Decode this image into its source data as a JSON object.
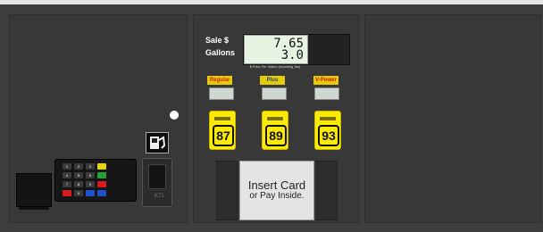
{
  "display": {
    "sale_label": "Sale $",
    "gallons_label": "Gallons",
    "sale_value": "7.65",
    "gallons_value": "3.0",
    "price_note": "$ Price Per Gallon (Including Tax)"
  },
  "grades": [
    {
      "label": "Regular",
      "label_color": "#d01c1c",
      "octane": "87"
    },
    {
      "label": "Plus",
      "label_color": "#1b3f9e",
      "octane": "89"
    },
    {
      "label": "V-Power",
      "label_color": "#e01010",
      "octane": "93"
    }
  ],
  "message": {
    "line1": "Insert Card",
    "line2": "or Pay Inside."
  },
  "card_reader": {
    "mark": "K71"
  },
  "keypad": {
    "keys": [
      {
        "label": "1",
        "color": "#3a3a3a"
      },
      {
        "label": "2",
        "color": "#3a3a3a"
      },
      {
        "label": "3",
        "color": "#3a3a3a"
      },
      {
        "label": "",
        "color": "#e6d400"
      },
      {
        "label": "4",
        "color": "#3a3a3a"
      },
      {
        "label": "5",
        "color": "#3a3a3a"
      },
      {
        "label": "6",
        "color": "#3a3a3a"
      },
      {
        "label": "",
        "color": "#25a233"
      },
      {
        "label": "7",
        "color": "#3a3a3a"
      },
      {
        "label": "8",
        "color": "#3a3a3a"
      },
      {
        "label": "9",
        "color": "#3a3a3a"
      },
      {
        "label": "",
        "color": "#d81c1c"
      },
      {
        "label": "",
        "color": "#d81c1c"
      },
      {
        "label": "0",
        "color": "#3a3a3a"
      },
      {
        "label": "",
        "color": "#1f50d0"
      },
      {
        "label": "",
        "color": "#1f50d0"
      }
    ]
  }
}
